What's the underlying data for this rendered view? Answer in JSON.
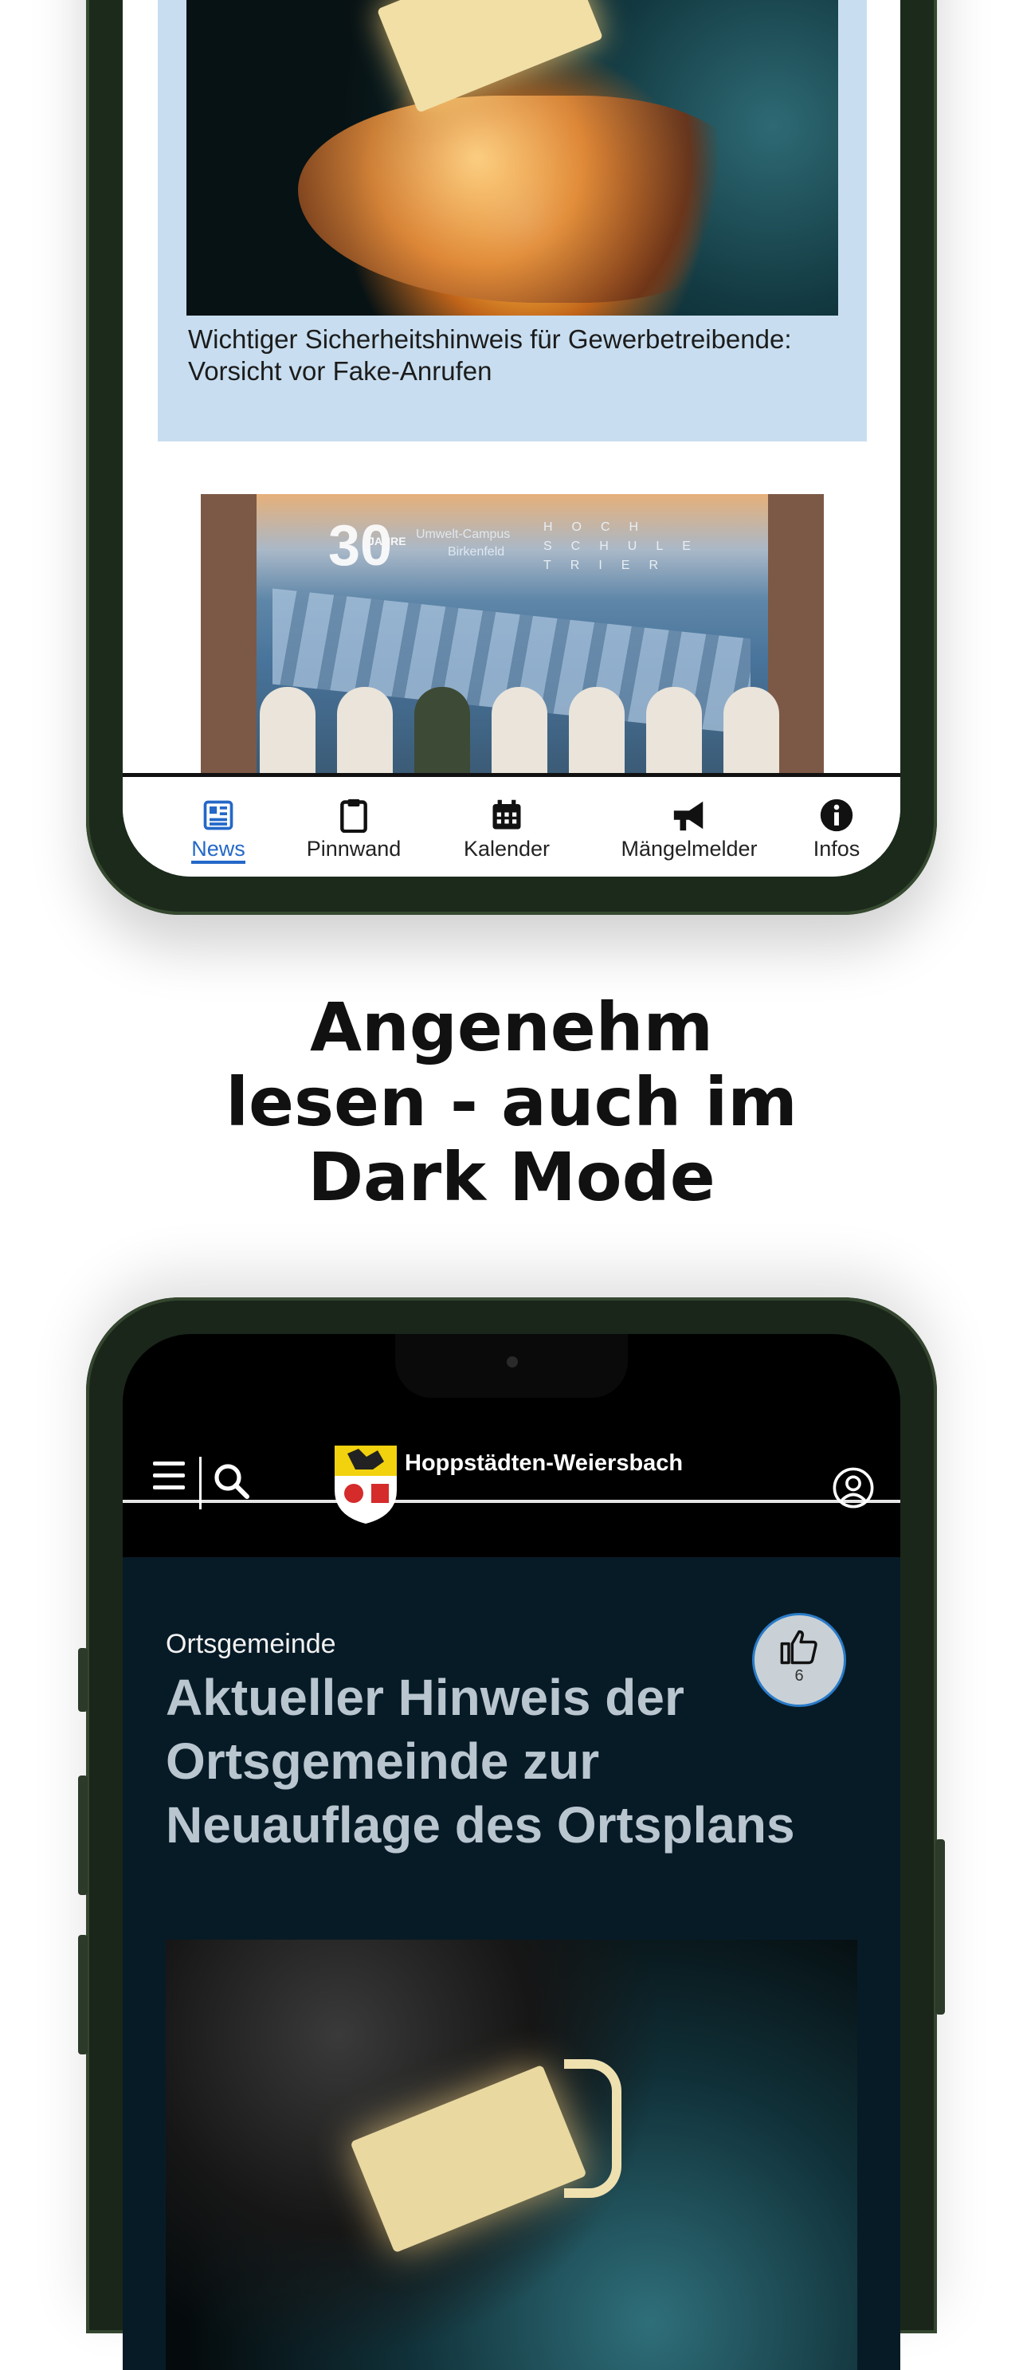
{
  "phone_top": {
    "news_cards": [
      {
        "caption": "Wichtiger Sicherheitshinweis für Gewerbetreibende: Vorsicht vor Fake-Anrufen"
      },
      {
        "image_text": {
          "big": "30",
          "campus_line1": "Umwelt-Campus",
          "campus_line2": "Birkenfeld",
          "hs_line1": "HOCH",
          "hs_line2": "SCHULE",
          "hs_line3": "TRIER",
          "jahre": "JAHRE"
        }
      }
    ],
    "tabbar": {
      "active": "News",
      "tabs": [
        {
          "label": "News",
          "icon": "newspaper-icon"
        },
        {
          "label": "Pinnwand",
          "icon": "clipboard-icon"
        },
        {
          "label": "Kalender",
          "icon": "calendar-icon"
        },
        {
          "label": "Mängelmelder",
          "icon": "megaphone-icon"
        },
        {
          "label": "Infos",
          "icon": "info-icon"
        }
      ]
    }
  },
  "headline": {
    "line1": "Angenehm",
    "line2": "lesen - auch im",
    "line3": "Dark Mode"
  },
  "phone_bottom": {
    "header": {
      "town_name": "Hoppstädten-Weiersbach"
    },
    "article": {
      "category": "Ortsgemeinde",
      "title": "Aktueller Hinweis der Ortsgemeinde zur Neuauflage des Ortsplans",
      "likes": "6"
    }
  },
  "colors": {
    "accent": "#2468c8",
    "light_card": "#c8def0",
    "dark_article_bg": "#071b27",
    "dark_title": "#b9c6cf"
  }
}
